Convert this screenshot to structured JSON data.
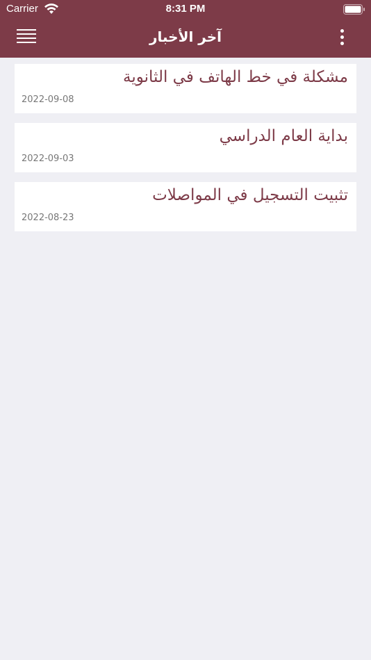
{
  "status_bar": {
    "carrier": "Carrier",
    "time": "8:31 PM"
  },
  "navbar": {
    "title": "آخر الأخبار",
    "menu_icon": "hamburger-menu-icon",
    "more_icon": "more-vertical-icon"
  },
  "news": [
    {
      "title": "مشكلة في خط الهاتف في الثانوية",
      "date": "2022-09-08"
    },
    {
      "title": "بداية العام الدراسي",
      "date": "2022-09-03"
    },
    {
      "title": "تثبيت التسجيل في المواصلات",
      "date": "2022-08-23"
    }
  ],
  "colors": {
    "header": "#7d3b48",
    "title_text": "#7d3b48",
    "background": "#efeff4",
    "card": "#ffffff"
  }
}
